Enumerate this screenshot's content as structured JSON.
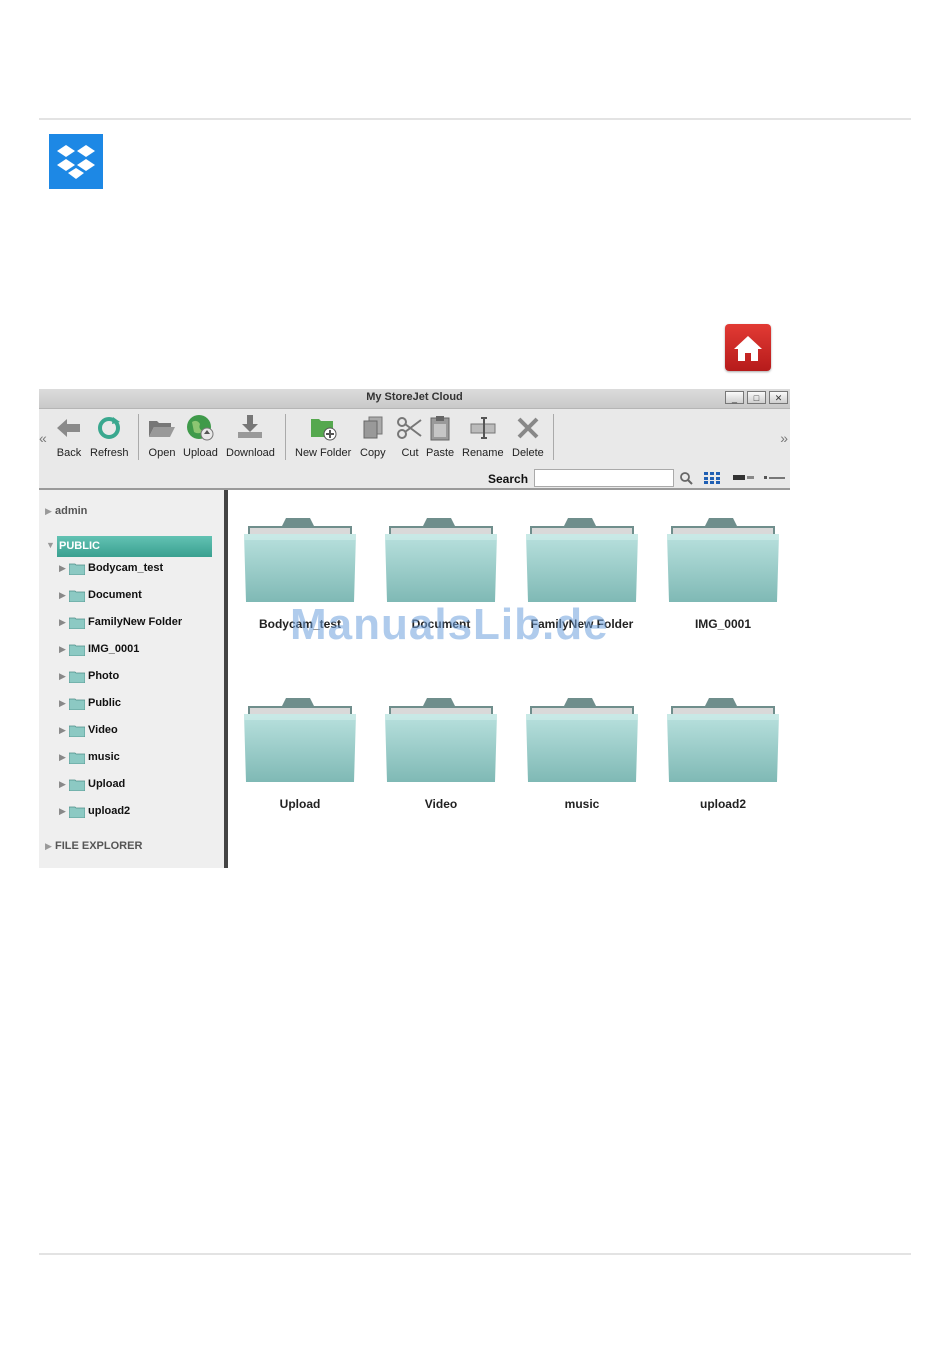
{
  "window": {
    "title": "My StoreJet Cloud",
    "controls": [
      "_",
      "□",
      "✕"
    ]
  },
  "toolbar": {
    "nav_left": "«",
    "nav_right": "»",
    "buttons": {
      "back": "Back",
      "refresh": "Refresh",
      "open": "Open",
      "upload": "Upload",
      "download": "Download",
      "new_folder": "New Folder",
      "copy": "Copy",
      "cut": "Cut",
      "paste": "Paste",
      "rename": "Rename",
      "delete": "Delete"
    },
    "search_label": "Search",
    "search_value": ""
  },
  "sidebar": {
    "admin": "admin",
    "public": "PUBLIC",
    "items": [
      "Bodycam_test",
      "Document",
      "FamilyNew Folder",
      "IMG_0001",
      "Photo",
      "Public",
      "Video",
      "music",
      "Upload",
      "upload2"
    ],
    "file_explorer": "FILE EXPLORER"
  },
  "grid": {
    "folders": [
      "Bodycam_test",
      "Document",
      "FamilyNew Folder",
      "IMG_0001",
      "Upload",
      "Video",
      "music",
      "upload2"
    ]
  },
  "watermark": "ManualsLib.de",
  "colors": {
    "accent": "#3aa090",
    "folder": "#a9d6d3",
    "home": "#d42a26",
    "dropbox": "#1d88e5"
  }
}
